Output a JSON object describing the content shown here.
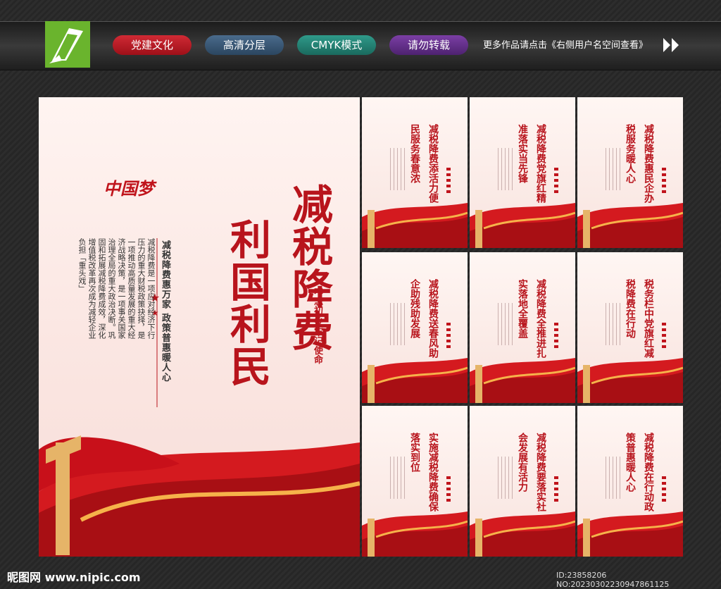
{
  "header": {
    "tags": [
      "党建文化",
      "高清分层",
      "CMYK模式",
      "请勿转载"
    ],
    "more_text": "更多作品请点击《右侧用户名空间查看》"
  },
  "main_poster": {
    "title_line1": "减税降费",
    "title_line2": "利国利民",
    "subtitle": "减税降费惠万家 政策普惠暖人心",
    "body": "减税降费是一项应对经济下行压力的重大财税政策抉择，是一项推动高质量发展的重大经济战略决策，是一项事关国家治理全局的重大政治决断。巩固和拓展减税降费成效，深化增值税改革再次成为减轻企业负担「重头戏」",
    "motto": "不忘初心 牢记使命",
    "logo_text": "中国梦"
  },
  "cards": [
    {
      "line1": "减税降费添活力",
      "line2": "便民服务春意浓"
    },
    {
      "line1": "减税降费党旗红",
      "line2": "精准落实当先锋"
    },
    {
      "line1": "减税降费惠民企",
      "line2": "办税服务暖人心"
    },
    {
      "line1": "减税降费送春风",
      "line2": "助企助残助发展"
    },
    {
      "line1": "减税降费全推进",
      "line2": "扎实落地全覆盖"
    },
    {
      "line1": "税务栏中党旗红",
      "line2": "减税降费在行动"
    },
    {
      "line1": "实施减税降费",
      "line2": "确保落实到位"
    },
    {
      "line1": "减税降费要落实",
      "line2": "社会发展有活力"
    },
    {
      "line1": "减税降费在行动",
      "line2": "政策普惠暖人心"
    }
  ],
  "watermark": {
    "left": "昵图网 www.nipic.com",
    "right": "ID:23858206 NO:20230302230947861125"
  }
}
